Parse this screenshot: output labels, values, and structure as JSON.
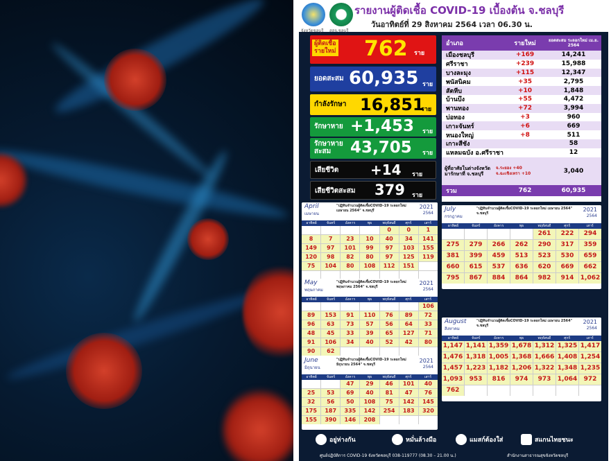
{
  "header": {
    "logo_left_caption": "จังหวัดชลบุรี",
    "logo_mid_caption": "สสจ.ชลบุรี",
    "title": "รายงานผู้ติดเชื้อ COVID-19 เบื้องต้น จ.ชลบุรี",
    "subtitle": "วันอาทิตย์ที่ 29 สิงหาคม 2564 เวลา 06.30 น."
  },
  "stats": [
    {
      "label": "ผู้ติดเชื้อ\nรายใหม่",
      "value": "762",
      "unit": "ราย"
    },
    {
      "label": "ยอดสะสม",
      "value": "60,935",
      "unit": "ราย"
    },
    {
      "label": "กำลังรักษา",
      "value": "16,851",
      "unit": "ราย"
    },
    {
      "label": "รักษาหาย",
      "value": "+1,453",
      "unit": "ราย"
    },
    {
      "label": "รักษาหาย\nสะสม",
      "value": "43,705",
      "unit": "ราย"
    },
    {
      "label": "เสียชีวิต",
      "value": "+14",
      "unit": "ราย"
    },
    {
      "label": "เสียชีวิตสะสม",
      "value": "379",
      "unit": "ราย"
    }
  ],
  "district_table": {
    "headers": [
      "อำเภอ",
      "รายใหม่",
      "ยอดสะสม ระลอกใหม่ เม.ย. 2564"
    ],
    "rows": [
      [
        "เมืองชลบุรี",
        "+169",
        "14,241"
      ],
      [
        "ศรีราชา",
        "+239",
        "15,988"
      ],
      [
        "บางละมุง",
        "+115",
        "12,347"
      ],
      [
        "พนัสนิคม",
        "+35",
        "2,795"
      ],
      [
        "สัตหีบ",
        "+10",
        "1,848"
      ],
      [
        "บ้านบึง",
        "+55",
        "4,472"
      ],
      [
        "พานทอง",
        "+72",
        "3,994"
      ],
      [
        "บ่อทอง",
        "+3",
        "960"
      ],
      [
        "เกาะจันทร์",
        "+6",
        "669"
      ],
      [
        "หนองใหญ่",
        "+8",
        "511"
      ],
      [
        "เกาะสีชัง",
        "",
        "58"
      ],
      [
        "แหลมฉบัง อ.ศรีราชา",
        "",
        "12"
      ]
    ],
    "outside_label": "ผู้ที่อาศัยในต่างจังหวัด มารักษาที่ จ.ชลบุรี",
    "outside_notes": [
      "จ.ระยอง +40",
      "จ.ฉะเชิงเทรา +10"
    ],
    "outside_value": "3,040",
    "total_label": "รวม",
    "total_new": "762",
    "total_cum": "60,935"
  },
  "calendars": [
    {
      "month": "April",
      "thai": "เมษายน",
      "year": "2021",
      "thai_year": "2564",
      "title": "\"ปฏิทินจำนวนผู้ติดเชื้อCOVID-19 ระลอกใหม่ เมษายน 2564\" จ.ชลบุรี",
      "cells": [
        "",
        "",
        "",
        "",
        "0",
        "0",
        "1",
        "8",
        "7",
        "23",
        "10",
        "40",
        "34",
        "141",
        "149",
        "97",
        "101",
        "99",
        "97",
        "103",
        "155",
        "120",
        "98",
        "82",
        "80",
        "97",
        "125",
        "119",
        "75",
        "104",
        "80",
        "108",
        "112",
        "151",
        "",
        "",
        ""
      ]
    },
    {
      "month": "May",
      "thai": "พฤษภาคม",
      "year": "2021",
      "thai_year": "2564",
      "title": "\"ปฏิทินจำนวนผู้ติดเชื้อCOVID-19 ระลอกใหม่ พฤษภาคม 2564\" จ.ชลบุรี",
      "cells": [
        "",
        "",
        "",
        "",
        "",
        "",
        "106",
        "89",
        "153",
        "91",
        "110",
        "76",
        "89",
        "72",
        "96",
        "63",
        "73",
        "57",
        "56",
        "64",
        "33",
        "48",
        "45",
        "33",
        "39",
        "65",
        "127",
        "71",
        "91",
        "106",
        "34",
        "40",
        "52",
        "42",
        "80",
        "90",
        "62",
        "",
        "",
        "",
        "",
        ""
      ]
    },
    {
      "month": "June",
      "thai": "มิถุนายน",
      "year": "2021",
      "thai_year": "2564",
      "title": "\"ปฏิทินจำนวนผู้ติดเชื้อCOVID-19 ระลอกใหม่ มิถุนายน 2564\" จ.ชลบุรี",
      "cells": [
        "",
        "",
        "47",
        "29",
        "46",
        "101",
        "40",
        "25",
        "53",
        "69",
        "40",
        "81",
        "47",
        "76",
        "32",
        "56",
        "50",
        "108",
        "75",
        "142",
        "145",
        "175",
        "187",
        "335",
        "142",
        "254",
        "183",
        "320",
        "155",
        "390",
        "146",
        "208",
        "",
        "",
        ""
      ]
    },
    {
      "month": "July",
      "thai": "กรกฎาคม",
      "year": "2021",
      "thai_year": "2564",
      "title": "\"ปฏิทินจำนวนผู้ติดเชื้อCOVID-19 ระลอกใหม่ เมษายน 2564\" จ.ชลบุรี",
      "cells": [
        "",
        "",
        "",
        "",
        "261",
        "222",
        "294",
        "275",
        "279",
        "266",
        "262",
        "290",
        "317",
        "359",
        "381",
        "399",
        "459",
        "513",
        "523",
        "530",
        "659",
        "660",
        "615",
        "537",
        "636",
        "620",
        "669",
        "662",
        "795",
        "867",
        "884",
        "864",
        "982",
        "914",
        "1,062"
      ]
    },
    {
      "month": "August",
      "thai": "สิงหาคม",
      "year": "2021",
      "thai_year": "2564",
      "title": "\"ปฏิทินจำนวนผู้ติดเชื้อCOVID-19 ระลอกใหม่ เมษายน 2564\" จ.ชลบุรี",
      "cells": [
        "1,147",
        "1,141",
        "1,359",
        "1,678",
        "1,312",
        "1,325",
        "1,417",
        "1,476",
        "1,318",
        "1,005",
        "1,368",
        "1,666",
        "1,408",
        "1,254",
        "1,457",
        "1,223",
        "1,182",
        "1,206",
        "1,322",
        "1,348",
        "1,235",
        "1,093",
        "953",
        "816",
        "974",
        "973",
        "1,064",
        "972",
        "762",
        "",
        "",
        "",
        "",
        "",
        ""
      ]
    }
  ],
  "footer": {
    "items": [
      "อยู่ห่างกัน",
      "หมั่นล้างมือ",
      "แมสก์ต้องใส่",
      "สแกนไทยชนะ"
    ],
    "hotline": "ศูนย์ปฏิบัติการ COVID-19 จังหวัดชลบุรี 038-119777 (08.30 – 21.00 น.)",
    "office": "สำนักงานสาธารณสุขจังหวัดชลบุรี"
  },
  "colors": {
    "purple": "#7a3cae",
    "red": "#e01414",
    "yellow": "#ffd800",
    "green": "#149a3c",
    "blue": "#1f3fa0",
    "black": "#0a0a0a"
  }
}
